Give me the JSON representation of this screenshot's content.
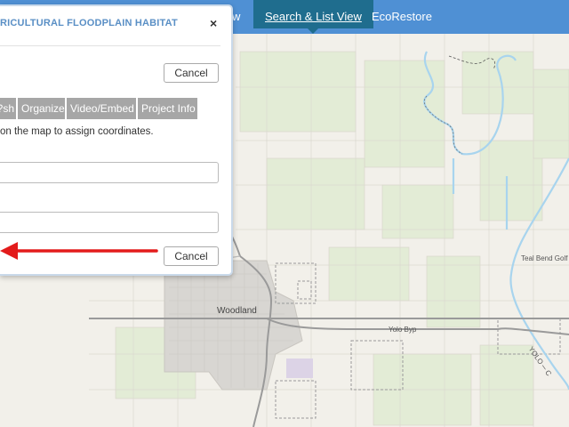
{
  "nav": {
    "items": [
      {
        "label": "w"
      },
      {
        "label": "Search & List View"
      },
      {
        "label": "EcoRestore"
      }
    ]
  },
  "dialog": {
    "title": "RICULTURAL FLOODPLAIN HABITAT",
    "close_glyph": "×",
    "cancel_top_label": "Cancel",
    "cancel_bottom_label": "Cancel",
    "tabs": [
      {
        "label": "sh?"
      },
      {
        "label": "Organize"
      },
      {
        "label": "Video/Embed"
      },
      {
        "label": "Project Info"
      }
    ],
    "instruction": "on the map to assign coordinates.",
    "field_1_value": "",
    "field_2_value": ""
  },
  "map": {
    "labels": {
      "woodland": "Woodland",
      "yolo_byp": "Yolo Byp",
      "golf": "Teal Bend Golf Club",
      "yolo_river": "YOLO ─ C"
    }
  },
  "colors": {
    "nav_bg": "#4f90d4",
    "nav_active": "#1f6d8e",
    "tab_bg": "#a6a6a6",
    "arrow": "#e31b1b",
    "map_bg": "#f2f0ea",
    "water": "#a8d4ee"
  }
}
